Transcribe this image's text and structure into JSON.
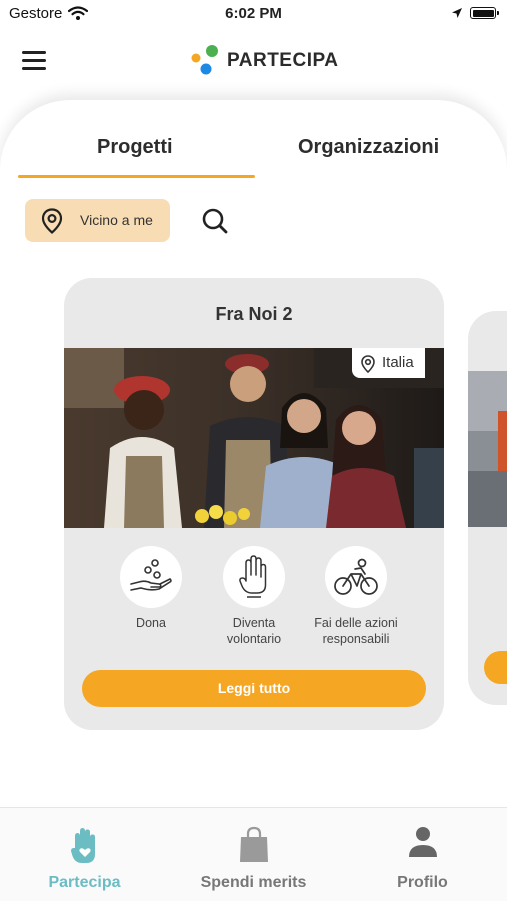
{
  "status_bar": {
    "carrier": "Gestore",
    "time": "6:02 PM",
    "icons": [
      "wifi-icon",
      "location-arrow-icon",
      "battery-icon"
    ]
  },
  "header": {
    "logo_text": "PARTECIPA",
    "logo_colors": [
      "#f5a623",
      "#4caf50",
      "#1e88e5"
    ],
    "menu_icon": "hamburger-icon"
  },
  "tabs": [
    {
      "label": "Progetti",
      "active": true
    },
    {
      "label": "Organizzazioni",
      "active": false
    }
  ],
  "filters": {
    "near_me_label": "Vicino a me",
    "near_me_icon": "map-pin-icon",
    "search_icon": "search-icon"
  },
  "project_card": {
    "title": "Fra Noi 2",
    "location": "Italia",
    "actions": [
      {
        "label": "Dona",
        "icon": "donate-hand-icon"
      },
      {
        "label": "Diventa volontario",
        "icon": "raised-hand-icon"
      },
      {
        "label": "Fai delle azioni responsabili",
        "icon": "cyclist-icon"
      }
    ],
    "button_label": "Leggi tutto"
  },
  "bottom_nav": [
    {
      "label": "Partecipa",
      "icon": "hand-heart-icon",
      "active": true
    },
    {
      "label": "Spendi merits",
      "icon": "shopping-bag-icon",
      "active": false
    },
    {
      "label": "Profilo",
      "icon": "user-icon",
      "active": false
    }
  ],
  "colors": {
    "accent": "#f5a623",
    "chip_background": "#f8dcb4",
    "nav_active": "#6cbcc4",
    "card_background": "#e9e9e9"
  }
}
